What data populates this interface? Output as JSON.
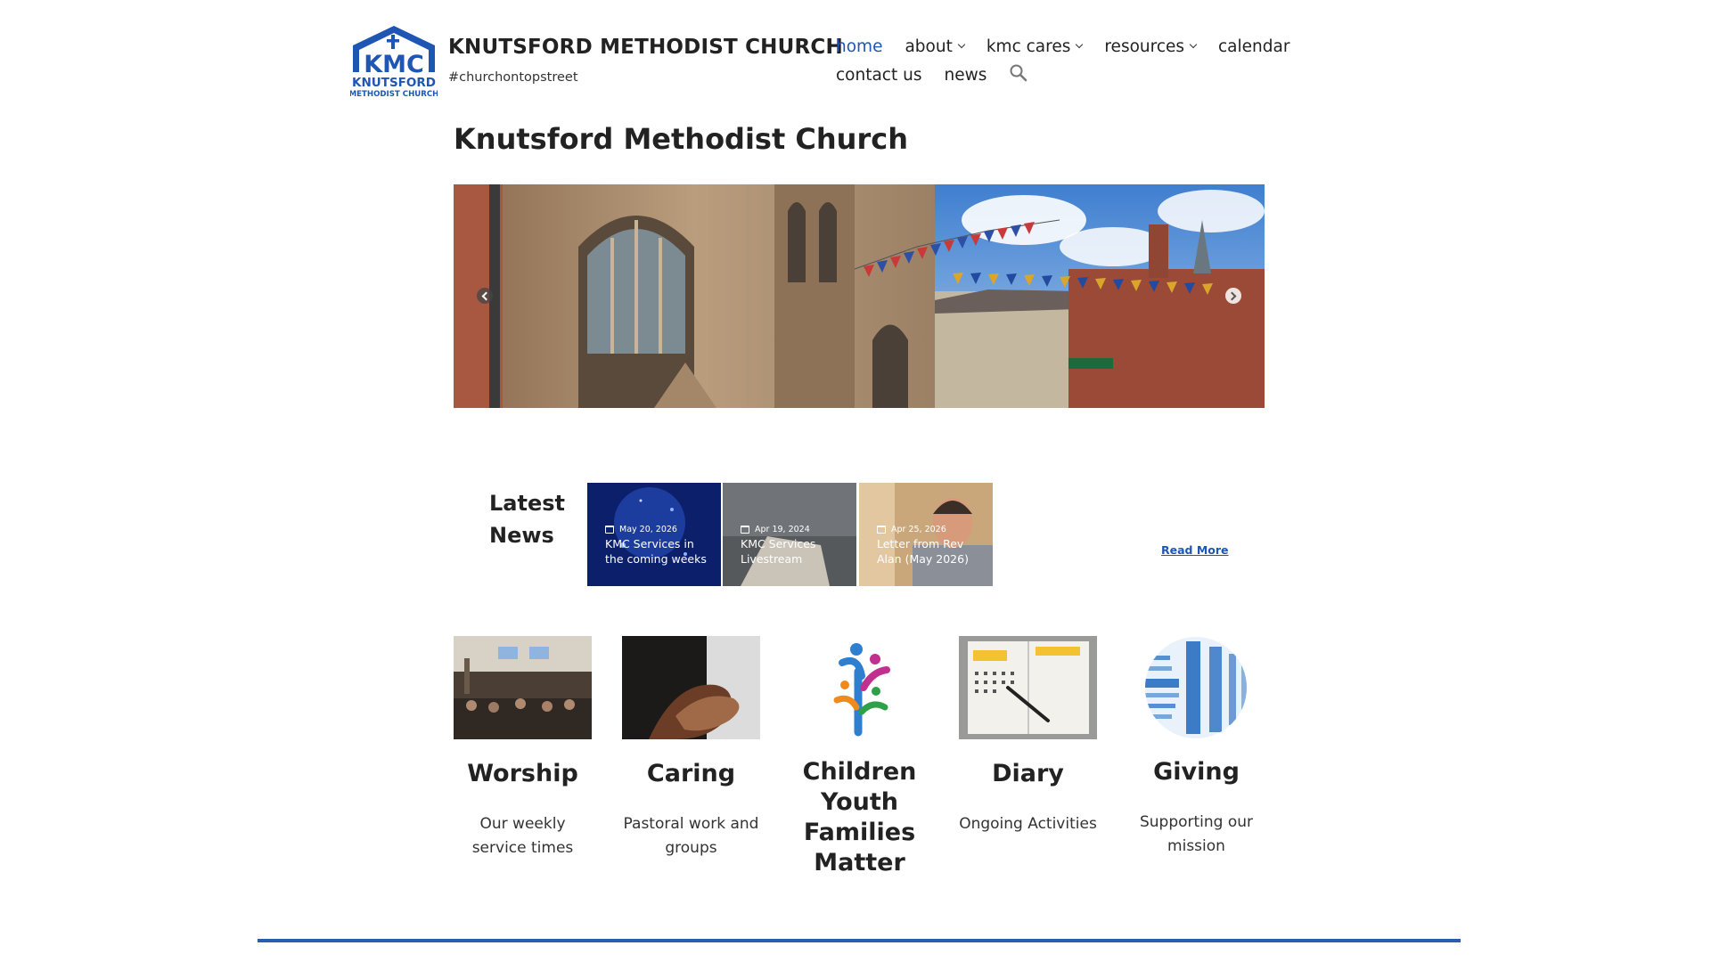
{
  "header": {
    "logo_text": [
      "KMC",
      "KNUTSFORD",
      "METHODIST CHURCH"
    ],
    "site_title": "KNUTSFORD METHODIST CHURCH",
    "tagline": "#churchontopstreet",
    "brand_color": "#1f56b3"
  },
  "nav": {
    "items": [
      {
        "label": "home",
        "active": true
      },
      {
        "label": "about",
        "dropdown": true
      },
      {
        "label": "kmc cares",
        "dropdown": true
      },
      {
        "label": "resources",
        "dropdown": true
      },
      {
        "label": "calendar"
      },
      {
        "label": "contact us"
      },
      {
        "label": "news"
      }
    ],
    "search_icon": "search-icon"
  },
  "page": {
    "title": "Knutsford Methodist Church"
  },
  "slider": {
    "prev_icon": "chevron-left-icon",
    "next_icon": "chevron-right-icon"
  },
  "news": {
    "heading": "Latest News",
    "items": [
      {
        "date": "May 20, 2026",
        "title": "KMC Services in the coming weeks"
      },
      {
        "date": "Apr 19, 2024",
        "title": "KMC Services Livestream"
      },
      {
        "date": "Apr 25, 2026",
        "title": "Letter from Rev Alan (May 2026)"
      }
    ],
    "read_more": "Read More"
  },
  "features": [
    {
      "title": "Worship",
      "desc": "Our weekly service times"
    },
    {
      "title": "Caring",
      "desc": "Pastoral work and groups"
    },
    {
      "title": "Children Youth Families Matter",
      "desc": ""
    },
    {
      "title": "Diary",
      "desc": "Ongoing Activities"
    },
    {
      "title": "Giving",
      "desc": "Supporting our mission"
    }
  ],
  "footer": {
    "rule_color": "#2a5db0"
  }
}
